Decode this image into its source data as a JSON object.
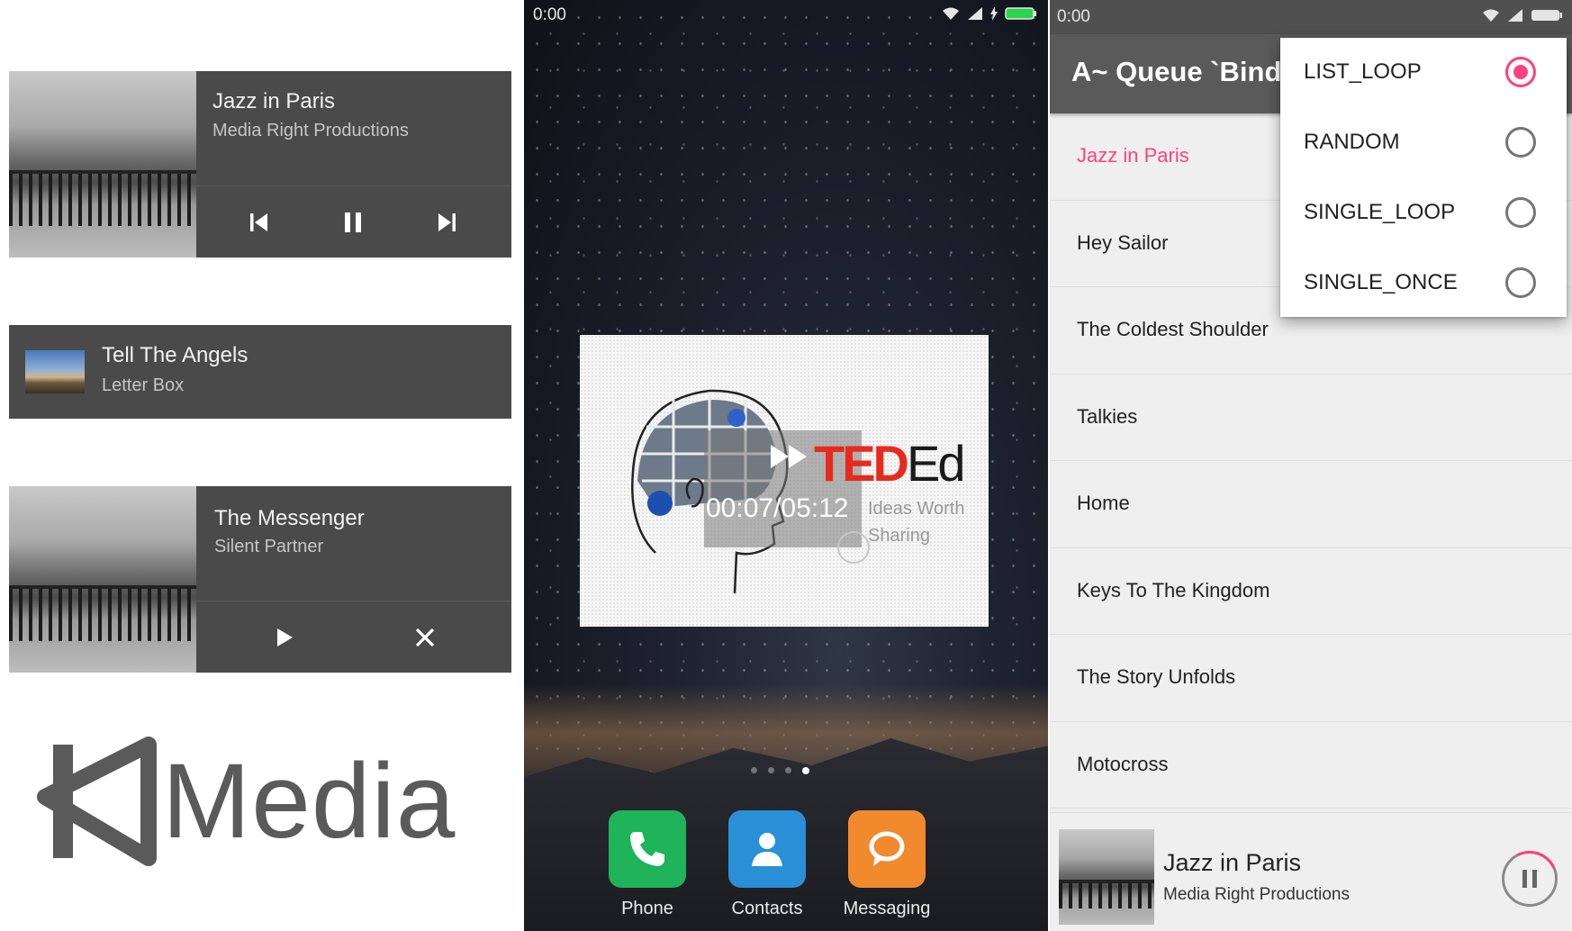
{
  "notifications": [
    {
      "title": "Jazz in Paris",
      "subtitle": "Media Right Productions",
      "controls": [
        "skip-previous-icon",
        "pause-icon",
        "skip-next-icon"
      ]
    },
    {
      "title": "Tell The Angels",
      "subtitle": "Letter Box"
    },
    {
      "title": "The Messenger",
      "subtitle": "Silent Partner",
      "controls": [
        "play-icon",
        "close-icon"
      ]
    }
  ],
  "logo": {
    "text": "Media"
  },
  "home": {
    "status_time": "0:00",
    "video": {
      "ted_a": "TED",
      "ted_b": "Ed",
      "tagline_1": "Ideas Worth",
      "tagline_2": "Sharing",
      "time": "00:07/05:12"
    },
    "page_dots": 4,
    "active_dot": 3,
    "dock": [
      {
        "label": "Phone",
        "color": "#1fb35a",
        "icon": "phone-icon"
      },
      {
        "label": "Contacts",
        "color": "#2a8fd6",
        "icon": "contacts-icon"
      },
      {
        "label": "Messaging",
        "color": "#f08a2d",
        "icon": "messaging-icon"
      }
    ]
  },
  "queue": {
    "status_time": "0:00",
    "title": "A~ Queue `Binding",
    "accent": "#ff4081",
    "items": [
      {
        "label": "Jazz in Paris",
        "active": true
      },
      {
        "label": "Hey Sailor"
      },
      {
        "label": "The Coldest Shoulder"
      },
      {
        "label": "Talkies"
      },
      {
        "label": "Home"
      },
      {
        "label": "Keys To The Kingdom"
      },
      {
        "label": "The Story Unfolds"
      },
      {
        "label": "Motocross"
      }
    ],
    "mode_menu": [
      {
        "label": "LIST_LOOP",
        "checked": true
      },
      {
        "label": "RANDOM",
        "checked": false
      },
      {
        "label": "SINGLE_LOOP",
        "checked": false
      },
      {
        "label": "SINGLE_ONCE",
        "checked": false
      }
    ],
    "player": {
      "title": "Jazz in Paris",
      "subtitle": "Media Right Productions",
      "icon": "pause-icon"
    }
  }
}
